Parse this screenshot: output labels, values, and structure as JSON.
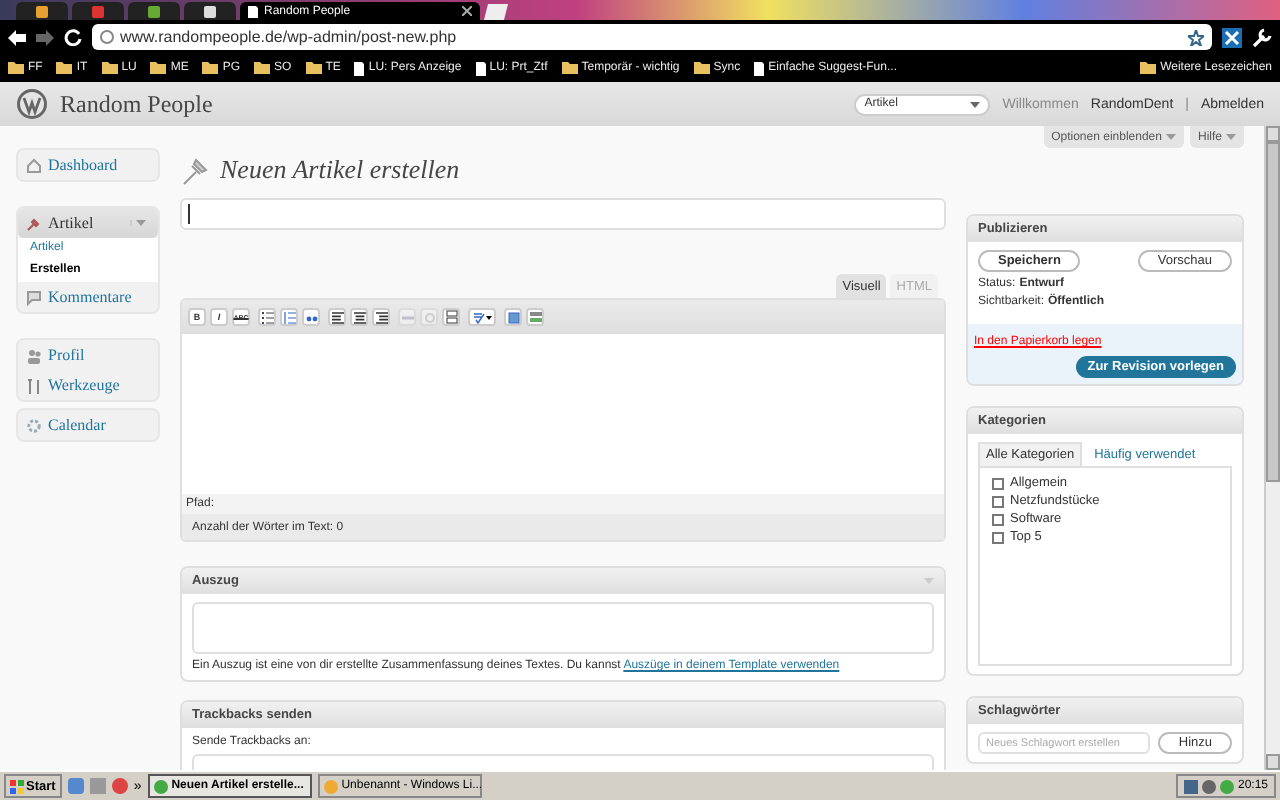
{
  "browser": {
    "tabs": [
      {
        "title": "Random People",
        "selected": true
      }
    ],
    "address": "www.randompeople.de/wp-admin/post-new.php",
    "bookmarks": [
      {
        "label": "FF",
        "kind": "folder"
      },
      {
        "label": "IT",
        "kind": "folder"
      },
      {
        "label": "LU",
        "kind": "folder"
      },
      {
        "label": "ME",
        "kind": "folder"
      },
      {
        "label": "PG",
        "kind": "folder"
      },
      {
        "label": "SO",
        "kind": "folder"
      },
      {
        "label": "TE",
        "kind": "folder"
      },
      {
        "label": "LU: Pers Anzeige",
        "kind": "page"
      },
      {
        "label": "LU: Prt_Ztf",
        "kind": "page"
      },
      {
        "label": "Temporär - wichtig",
        "kind": "folder"
      },
      {
        "label": "Sync",
        "kind": "folder"
      },
      {
        "label": "Einfache Suggest-Fun...",
        "kind": "page"
      }
    ],
    "other_bookmarks": "Weitere Lesezeichen"
  },
  "site": {
    "title": "Random People",
    "quick_menu": "Artikel",
    "greeting": "Willkommen",
    "user": "RandomDent",
    "separator": "|",
    "logout": "Abmelden"
  },
  "sidebar": [
    [
      {
        "label": "Dashboard",
        "kind": "home"
      }
    ],
    [
      {
        "label": "Artikel",
        "kind": "pin",
        "expanded": true,
        "children": [
          {
            "label": "Artikel",
            "selected": false
          },
          {
            "label": "Erstellen",
            "selected": true
          }
        ]
      },
      {
        "label": "Kommentare",
        "kind": "bubble"
      }
    ],
    [
      {
        "label": "Profil",
        "kind": "users"
      },
      {
        "label": "Werkzeuge",
        "kind": "tools"
      }
    ],
    [
      {
        "label": "Calendar",
        "kind": "gear"
      }
    ]
  ],
  "screen_buttons": [
    "Optionen einblenden",
    "Hilfe"
  ],
  "page_title": "Neuen Artikel erstellen",
  "editor": {
    "tabs": [
      {
        "label": "Visuell",
        "selected": true
      },
      {
        "label": "HTML",
        "selected": false
      }
    ],
    "toolbar": [
      [
        {
          "kind": "bold",
          "label": "B",
          "disabled": false
        },
        {
          "kind": "italic",
          "label": "I",
          "disabled": false
        },
        {
          "kind": "strike",
          "label": "ABC",
          "disabled": false
        }
      ],
      [
        {
          "kind": "bullets",
          "disabled": false
        },
        {
          "kind": "numbers",
          "disabled": false
        },
        {
          "kind": "quote",
          "disabled": false
        }
      ],
      [
        {
          "kind": "left",
          "disabled": false
        },
        {
          "kind": "center",
          "disabled": false
        },
        {
          "kind": "right",
          "disabled": false
        }
      ],
      [
        {
          "kind": "link",
          "disabled": true
        },
        {
          "kind": "unlink",
          "disabled": true
        },
        {
          "kind": "more",
          "disabled": false
        }
      ],
      [
        {
          "kind": "spell",
          "disabled": false
        }
      ],
      [
        {
          "kind": "fullscreen",
          "disabled": false
        },
        {
          "kind": "kitchen",
          "disabled": false
        }
      ]
    ],
    "path_label": "Pfad:",
    "word_count": "Anzahl der Wörter im Text: 0"
  },
  "excerpt": {
    "title": "Auszug",
    "text": "Ein Auszug ist eine von dir erstellte Zusammenfassung deines Textes. Du kannst",
    "link": "Auszüge in deinem Template verwenden"
  },
  "trackbacks": {
    "title": "Trackbacks senden",
    "label": "Sende Trackbacks an:"
  },
  "publish": {
    "title": "Publizieren",
    "save": "Speichern",
    "preview": "Vorschau",
    "status_label": "Status:",
    "status": "Entwurf",
    "visibility_label": "Sichtbarkeit:",
    "visibility": "Öffentlich",
    "trash": "In den Papierkorb legen",
    "submit": "Zur Revision vorlegen"
  },
  "categories": {
    "title": "Kategorien",
    "tabs": [
      {
        "label": "Alle Kategorien",
        "selected": true
      },
      {
        "label": "Häufig verwendet",
        "selected": false
      }
    ],
    "items": [
      {
        "label": "Allgemein",
        "checked": false
      },
      {
        "label": "Netzfundstücke",
        "checked": false
      },
      {
        "label": "Software",
        "checked": false
      },
      {
        "label": "Top 5",
        "checked": false
      }
    ]
  },
  "tags": {
    "title": "Schlagwörter",
    "placeholder": "Neues Schlagwort erstellen",
    "button": "Hinzu"
  },
  "taskbar": {
    "start": "Start",
    "overflow": "»",
    "windows": [
      {
        "title": "Neuen Artikel erstelle...",
        "selected": true
      },
      {
        "title": "Unbenannt - Windows Li...",
        "selected": false
      }
    ],
    "clock": "20:15"
  }
}
